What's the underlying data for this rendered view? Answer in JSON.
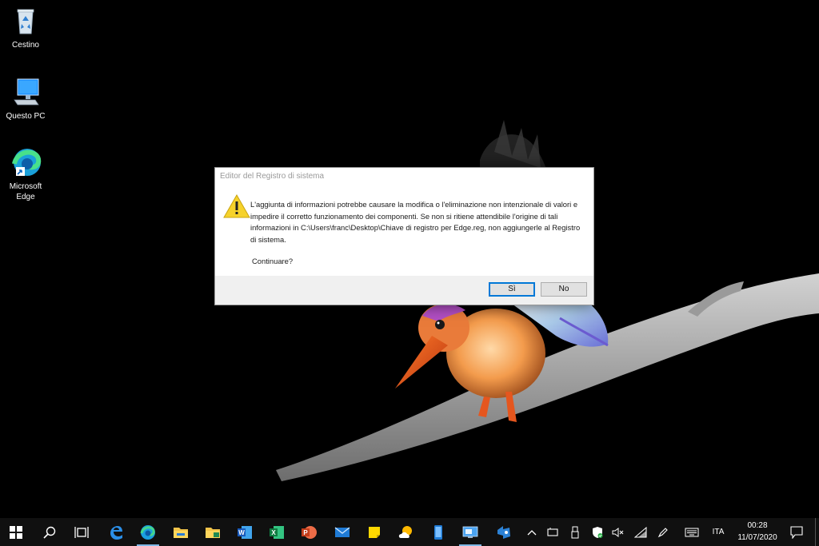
{
  "desktop": {
    "icons": [
      {
        "label": "Cestino"
      },
      {
        "label": "Questo PC"
      },
      {
        "label": "Microsoft Edge"
      }
    ]
  },
  "dialog": {
    "title": "Editor del Registro di sistema",
    "message": "L'aggiunta di informazioni potrebbe causare la modifica o l'eliminazione non intenzionale di valori e impedire il corretto funzionamento dei componenti. Se non si ritiene attendibile l'origine di tali informazioni in C:\\Users\\franc\\Desktop\\Chiave di registro per Edge.reg, non aggiungerle al Registro di sistema.",
    "question": "Continuare?",
    "yes_label": "Sì",
    "no_label": "No"
  },
  "taskbar": {
    "apps": [
      "start-icon",
      "search-icon",
      "task-view-icon",
      "edge-legacy-icon",
      "edge-icon",
      "file-explorer-icon",
      "file-explorer-2-icon",
      "word-icon",
      "excel-icon",
      "powerpoint-icon",
      "mail-icon",
      "sticky-notes-icon",
      "weather-icon",
      "phone-icon",
      "remote-desktop-icon",
      "azure-devops-icon"
    ],
    "tray": {
      "language": "ITA",
      "time": "00:28",
      "date": "11/07/2020"
    }
  },
  "colors": {
    "accent": "#0078d7",
    "taskbar": "#101010",
    "dialog_footer": "#f0f0f0"
  }
}
